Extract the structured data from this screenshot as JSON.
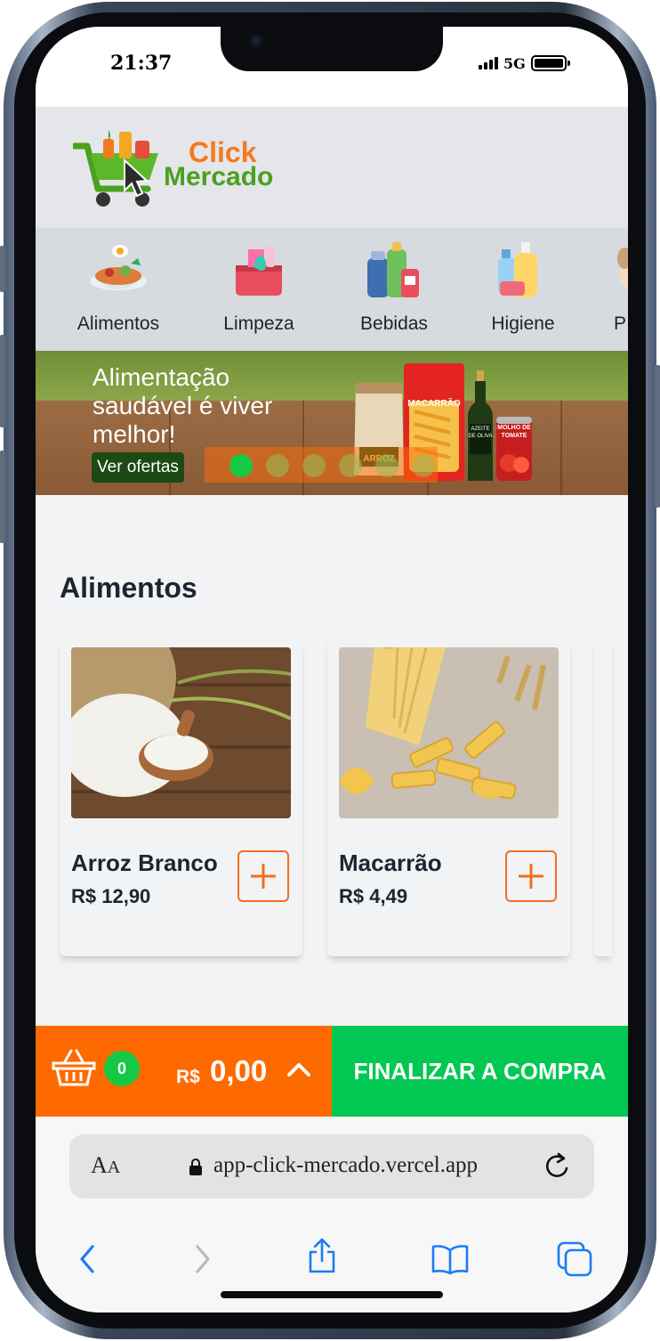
{
  "status_bar": {
    "time": "21:37",
    "network": "5G"
  },
  "brand": {
    "click": "Click",
    "mercado": "Mercado"
  },
  "categories": [
    {
      "label": "Alimentos",
      "icon": "food-bowl-icon"
    },
    {
      "label": "Limpeza",
      "icon": "cleaning-bucket-icon"
    },
    {
      "label": "Bebidas",
      "icon": "drink-bottles-icon"
    },
    {
      "label": "Higiene",
      "icon": "hygiene-bottles-icon"
    },
    {
      "label": "P",
      "icon": "pet-icon"
    }
  ],
  "banner": {
    "title": "Alimentação saudável é viver melhor!",
    "cta": "Ver ofertas",
    "slides_count": 6,
    "active_slide": 1,
    "products": {
      "rice": "ARROZ",
      "pasta": "MACARRÃO",
      "oil": "AZEITE DE OLIVA",
      "tomato": "MOLHO DE TOMATE"
    }
  },
  "section": {
    "title": "Alimentos"
  },
  "products": [
    {
      "name": "Arroz Branco",
      "price": "R$ 12,90"
    },
    {
      "name": "Macarrão",
      "price": "R$ 4,49"
    }
  ],
  "cart": {
    "count": "0",
    "currency": "R$",
    "total": "0,00",
    "checkout_label": "FINALIZAR A COMPRA"
  },
  "browser": {
    "text_size_label": "AA",
    "url": "app-click-mercado.vercel.app"
  },
  "colors": {
    "brand_orange": "#ff6a00",
    "brand_green": "#00c853",
    "dot_active": "#16c944"
  }
}
